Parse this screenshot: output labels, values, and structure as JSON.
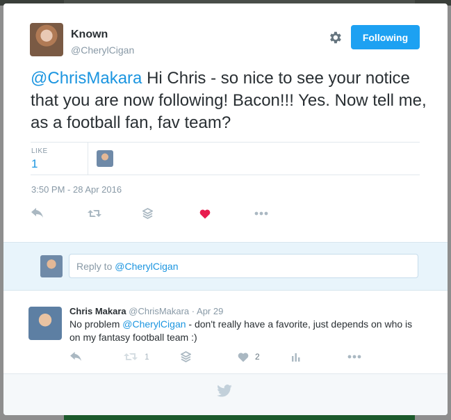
{
  "author": {
    "name": "Known",
    "handle": "@CherylCigan"
  },
  "follow_button": {
    "label": "Following"
  },
  "tweet": {
    "mention": "@ChrisMakara",
    "text": " Hi Chris - so nice to see your notice that you are now following! Bacon!!! Yes. Now tell me, as a football fan, fav team?",
    "likes_label": "LIKE",
    "likes_count": "1",
    "timestamp": "3:50 PM - 28 Apr 2016"
  },
  "reply_box": {
    "prefix": "Reply to ",
    "mention": "@CherylCigan"
  },
  "reply_tweet": {
    "name": "Chris Makara",
    "handle": "@ChrisMakara",
    "date": "· Apr 29",
    "text_before": "No problem ",
    "mention": "@CherylCigan",
    "text_after": " - don't really have a favorite, just depends on who is on my fantasy football team :)",
    "retweet_count": "1",
    "like_count": "2"
  },
  "icons": {
    "settings": "gear-icon",
    "reply": "reply-icon",
    "retweet": "retweet-icon",
    "stack": "stack-icon",
    "like": "heart-icon",
    "more": "more-icon",
    "analytics": "analytics-icon",
    "brand": "twitter-bird-icon"
  },
  "colors": {
    "accent": "#1da1f2",
    "link": "#1b95e0",
    "like_active": "#e81c4f",
    "muted": "#8899a6"
  }
}
